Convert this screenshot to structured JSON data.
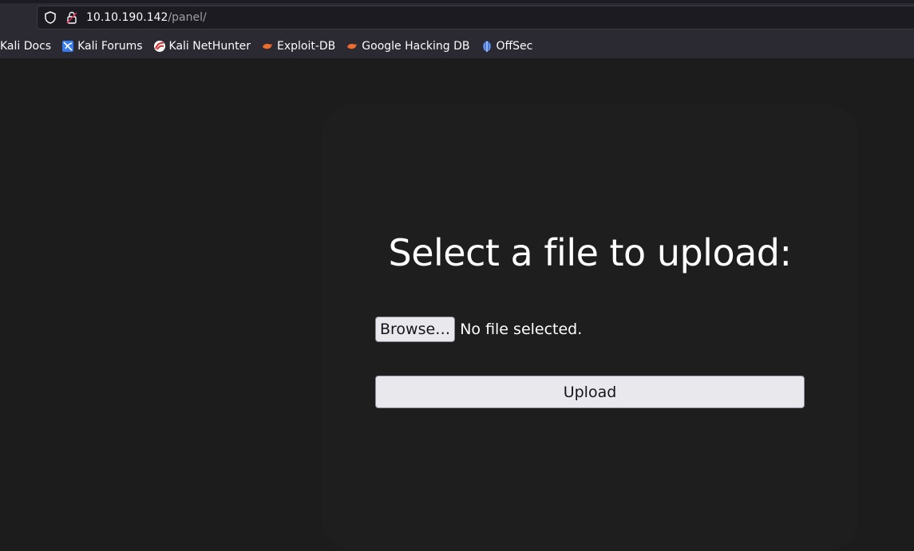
{
  "address_bar": {
    "host": "10.10.190.142",
    "path": "/panel/"
  },
  "bookmarks": [
    {
      "label": "Kali Docs",
      "icon": "kali-docs-icon"
    },
    {
      "label": "Kali Forums",
      "icon": "kali-forums-icon"
    },
    {
      "label": "Kali NetHunter",
      "icon": "kali-nethunter-icon"
    },
    {
      "label": "Exploit-DB",
      "icon": "exploit-db-icon"
    },
    {
      "label": "Google Hacking DB",
      "icon": "google-hacking-db-icon"
    },
    {
      "label": "OffSec",
      "icon": "offsec-icon"
    }
  ],
  "upload_form": {
    "heading": "Select a file to upload:",
    "browse_label": "Browse…",
    "file_status": "No file selected.",
    "upload_label": "Upload"
  }
}
